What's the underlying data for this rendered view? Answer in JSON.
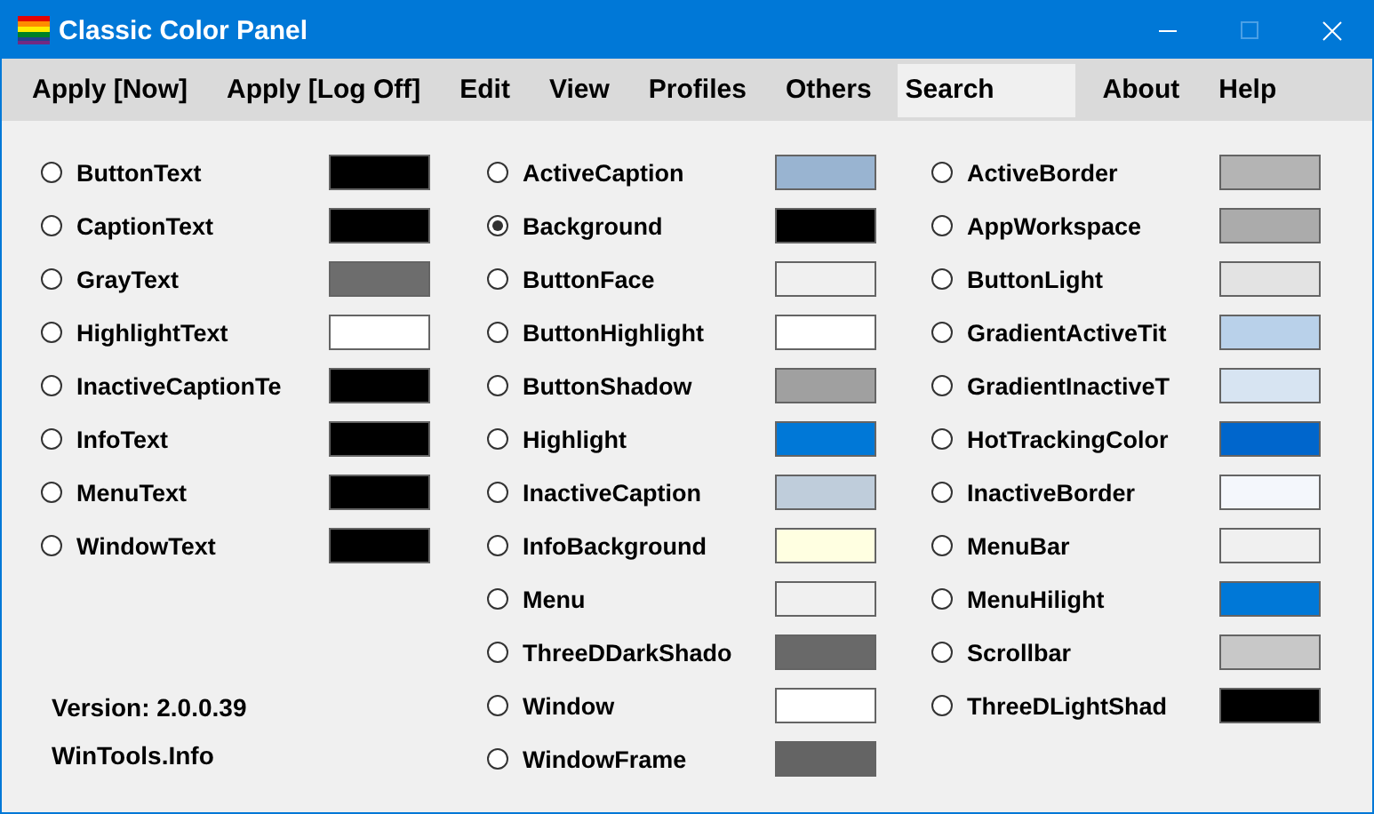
{
  "window": {
    "title": "Classic Color Panel"
  },
  "menu": [
    {
      "kind": "item",
      "label": "Apply [Now]"
    },
    {
      "kind": "item",
      "label": "Apply [Log Off]"
    },
    {
      "kind": "item",
      "label": "Edit"
    },
    {
      "kind": "item",
      "label": "View"
    },
    {
      "kind": "item",
      "label": "Profiles"
    },
    {
      "kind": "item",
      "label": "Others"
    },
    {
      "kind": "search",
      "value": "Search"
    },
    {
      "kind": "item",
      "label": "About"
    },
    {
      "kind": "item",
      "label": "Help"
    }
  ],
  "columns": [
    {
      "items": [
        {
          "name": "ButtonText",
          "color": "#000000",
          "selected": false
        },
        {
          "name": "CaptionText",
          "color": "#000000",
          "selected": false
        },
        {
          "name": "GrayText",
          "color": "#6d6d6d",
          "selected": false
        },
        {
          "name": "HighlightText",
          "color": "#ffffff",
          "selected": false
        },
        {
          "name": "InactiveCaptionTe",
          "color": "#000000",
          "selected": false
        },
        {
          "name": "InfoText",
          "color": "#000000",
          "selected": false
        },
        {
          "name": "MenuText",
          "color": "#000000",
          "selected": false
        },
        {
          "name": "WindowText",
          "color": "#000000",
          "selected": false
        }
      ]
    },
    {
      "items": [
        {
          "name": "ActiveCaption",
          "color": "#99b4d1",
          "selected": false
        },
        {
          "name": "Background",
          "color": "#000000",
          "selected": true
        },
        {
          "name": "ButtonFace",
          "color": "#f0f0f0",
          "selected": false
        },
        {
          "name": "ButtonHighlight",
          "color": "#ffffff",
          "selected": false
        },
        {
          "name": "ButtonShadow",
          "color": "#a0a0a0",
          "selected": false
        },
        {
          "name": "Highlight",
          "color": "#0078d7",
          "selected": false
        },
        {
          "name": "InactiveCaption",
          "color": "#bfcddb",
          "selected": false
        },
        {
          "name": "InfoBackground",
          "color": "#ffffe1",
          "selected": false
        },
        {
          "name": "Menu",
          "color": "#f0f0f0",
          "selected": false
        },
        {
          "name": "ThreeDDarkShado",
          "color": "#696969",
          "selected": false
        },
        {
          "name": "Window",
          "color": "#ffffff",
          "selected": false
        },
        {
          "name": "WindowFrame",
          "color": "#646464",
          "selected": false
        }
      ]
    },
    {
      "items": [
        {
          "name": "ActiveBorder",
          "color": "#b4b4b4",
          "selected": false
        },
        {
          "name": "AppWorkspace",
          "color": "#ababab",
          "selected": false
        },
        {
          "name": "ButtonLight",
          "color": "#e3e3e3",
          "selected": false
        },
        {
          "name": "GradientActiveTit",
          "color": "#b9d1ea",
          "selected": false
        },
        {
          "name": "GradientInactiveT",
          "color": "#d7e4f2",
          "selected": false
        },
        {
          "name": "HotTrackingColor",
          "color": "#0066cc",
          "selected": false
        },
        {
          "name": "InactiveBorder",
          "color": "#f4f7fc",
          "selected": false
        },
        {
          "name": "MenuBar",
          "color": "#f0f0f0",
          "selected": false
        },
        {
          "name": "MenuHilight",
          "color": "#0078d7",
          "selected": false
        },
        {
          "name": "Scrollbar",
          "color": "#c8c8c8",
          "selected": false
        },
        {
          "name": "ThreeDLightShad",
          "color": "#000000",
          "selected": false
        }
      ]
    }
  ],
  "footer": [
    "Version: 2.0.0.39",
    "WinTools.Info"
  ]
}
